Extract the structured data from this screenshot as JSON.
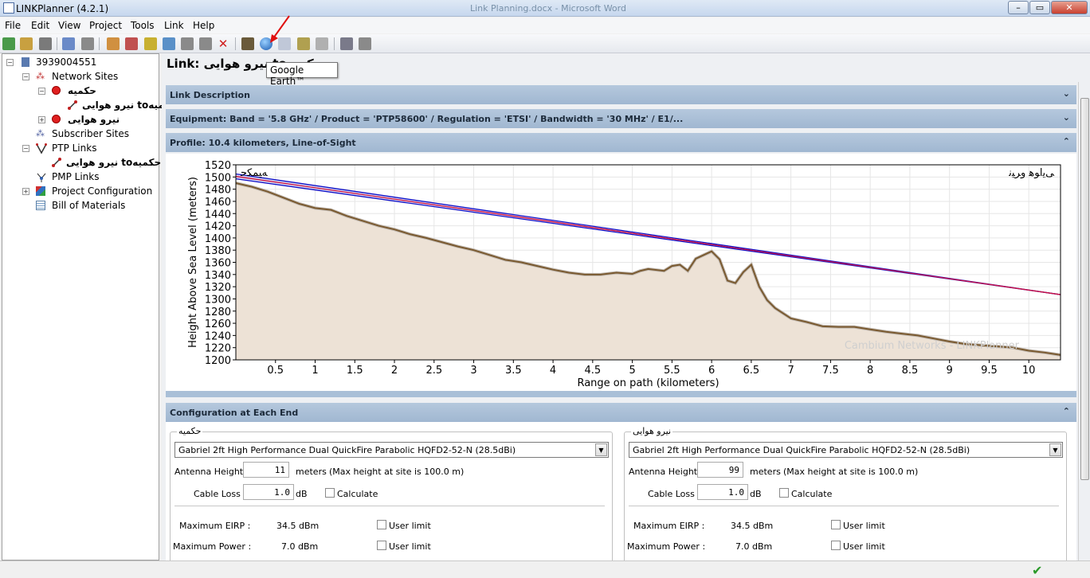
{
  "window": {
    "title": "LINKPlanner (4.2.1)",
    "background_window_title": "Link Planning.docx - Microsoft Word",
    "minimize": "–",
    "maximize": "▭",
    "close": "✕"
  },
  "menu": [
    "File",
    "Edit",
    "View",
    "Project",
    "Tools",
    "Link",
    "Help"
  ],
  "tooltip": "Google Earth™",
  "tree": {
    "root": "3939004551",
    "network_sites": "Network Sites",
    "site1": "حکمیه",
    "link1": "نیرو هوایی toحکمیه",
    "site2": "نیرو هوایی",
    "subscriber_sites": "Subscriber Sites",
    "ptp_links": "PTP Links",
    "ptp_link1": "نیرو هوایی toحکمیه",
    "pmp_links": "PMP Links",
    "project_configuration": "Project Configuration",
    "bill_of_materials": "Bill of Materials"
  },
  "link_title": "Link: نیرو هوایی toحکمیه",
  "sections": {
    "description": "Link Description",
    "equipment": "Equipment: Band = '5.8 GHz' / Product = 'PTP58600' / Regulation = 'ETSI' / Bandwidth = '30 MHz' / E1/...",
    "profile": "Profile: 10.4 kilometers, Line-of-Sight",
    "configuration": "Configuration at Each End",
    "collapse_chevron": "⌃",
    "expand_chevron": "⌄"
  },
  "chart_data": {
    "type": "area",
    "xlabel": "Range on path (kilometers)",
    "ylabel": "Height Above Sea Level (meters)",
    "xlim": [
      0,
      10.4
    ],
    "ylim": [
      1200,
      1520
    ],
    "xticks": [
      0.5,
      1,
      1.5,
      2,
      2.5,
      3,
      3.5,
      4,
      4.5,
      5,
      5.5,
      6,
      6.5,
      7,
      7.5,
      8,
      8.5,
      9,
      9.5,
      10
    ],
    "yticks": [
      1200,
      1220,
      1240,
      1260,
      1280,
      1300,
      1320,
      1340,
      1360,
      1380,
      1400,
      1420,
      1440,
      1460,
      1480,
      1500,
      1520
    ],
    "grid": true,
    "left_site_label": "ﻪﯿﻤﮑﺣ",
    "right_site_label": "ﯽﯾاﻮﻫ وﺮﯿﻧ",
    "watermark": "Cambium Networks - LINKPlanner",
    "terrain": {
      "x": [
        0,
        0.2,
        0.4,
        0.6,
        0.8,
        1.0,
        1.2,
        1.4,
        1.6,
        1.8,
        2.0,
        2.2,
        2.4,
        2.6,
        2.8,
        3.0,
        3.2,
        3.4,
        3.6,
        3.8,
        4.0,
        4.2,
        4.4,
        4.6,
        4.8,
        5.0,
        5.1,
        5.2,
        5.4,
        5.5,
        5.6,
        5.7,
        5.8,
        5.9,
        6.0,
        6.1,
        6.2,
        6.3,
        6.4,
        6.5,
        6.6,
        6.7,
        6.8,
        7.0,
        7.2,
        7.4,
        7.6,
        7.8,
        8.0,
        8.2,
        8.4,
        8.6,
        8.8,
        9.0,
        9.2,
        9.4,
        9.6,
        9.8,
        10.0,
        10.2,
        10.4
      ],
      "y": [
        1490,
        1484,
        1476,
        1466,
        1456,
        1449,
        1446,
        1436,
        1428,
        1420,
        1414,
        1406,
        1400,
        1393,
        1386,
        1380,
        1372,
        1364,
        1360,
        1354,
        1348,
        1343,
        1340,
        1340,
        1343,
        1341,
        1346,
        1349,
        1346,
        1354,
        1356,
        1346,
        1366,
        1372,
        1378,
        1365,
        1330,
        1326,
        1344,
        1356,
        1320,
        1298,
        1285,
        1268,
        1262,
        1255,
        1254,
        1254,
        1250,
        1246,
        1243,
        1240,
        1235,
        1230,
        1226,
        1224,
        1222,
        1220,
        1215,
        1212,
        1208
      ]
    },
    "fresnel_upper": {
      "x": [
        0,
        10.4
      ],
      "y": [
        1505,
        1307
      ]
    },
    "fresnel_lower": {
      "x": [
        0,
        10.4
      ],
      "y": [
        1497,
        1307
      ]
    },
    "line_of_sight": {
      "x": [
        0,
        10.4
      ],
      "y": [
        1501,
        1307
      ],
      "color": "#d01040"
    },
    "fresnel_color": "#1010c8",
    "terrain_fill": "#ede2d6",
    "terrain_line": "#7a5a30"
  },
  "config": {
    "left": {
      "site_name": "حکمیه",
      "antenna": "Gabriel 2ft High Performance Dual QuickFire Parabolic HQFD2-52-N (28.5dBi)",
      "antenna_height_label": "Antenna Height :",
      "antenna_height": "11",
      "height_unit": "meters",
      "max_height": "(Max height at site is 100.0 m)",
      "cable_loss_label": "Cable Loss :",
      "cable_loss": "1.0",
      "cable_unit": "dB",
      "calculate": "Calculate",
      "max_eirp_label": "Maximum EIRP :",
      "max_eirp": "34.5 dBm",
      "max_power_label": "Maximum Power :",
      "max_power": "7.0 dBm",
      "user_limit": "User limit"
    },
    "right": {
      "site_name": "نیرو هوایی",
      "antenna": "Gabriel 2ft High Performance Dual QuickFire Parabolic HQFD2-52-N (28.5dBi)",
      "antenna_height_label": "Antenna Height :",
      "antenna_height": "99",
      "height_unit": "meters",
      "max_height": "(Max height at site is 100.0 m)",
      "cable_loss_label": "Cable Loss :",
      "cable_loss": "1.0",
      "cable_unit": "dB",
      "calculate": "Calculate",
      "max_eirp_label": "Maximum EIRP :",
      "max_eirp": "34.5 dBm",
      "max_power_label": "Maximum Power :",
      "max_power": "7.0 dBm",
      "user_limit": "User limit"
    }
  },
  "status": {
    "ok_icon": "✔"
  }
}
